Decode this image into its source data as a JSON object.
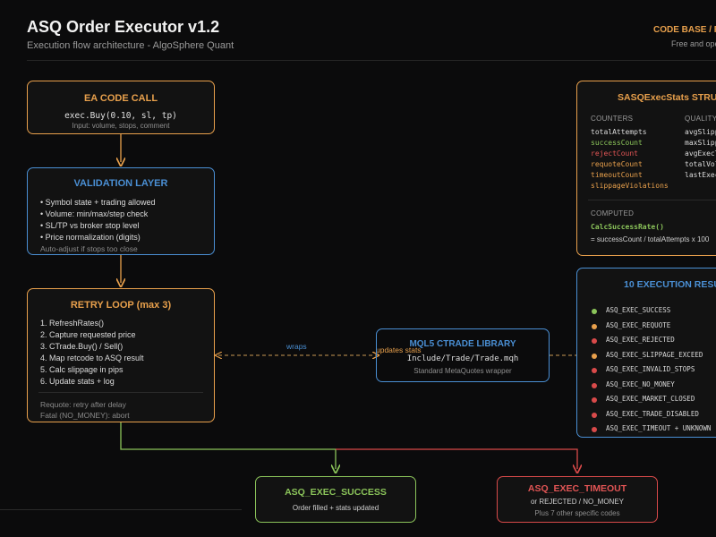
{
  "header": {
    "title": "ASQ Order Executor v1.2",
    "subtitle": "Execution flow architecture - AlgoSphere Quant",
    "codebase_title": "CODE BASE / PU",
    "codebase_sub": "Free and ope"
  },
  "ea_call": {
    "title": "EA CODE CALL",
    "code": "exec.Buy(0.10, sl, tp)",
    "note": "Input: volume, stops, comment"
  },
  "validation": {
    "title": "VALIDATION LAYER",
    "items": [
      "• Symbol state + trading allowed",
      "• Volume: min/max/step check",
      "• SL/TP vs broker stop level",
      "• Price normalization (digits)"
    ],
    "note": "Auto-adjust if stops too close"
  },
  "retry": {
    "title": "RETRY LOOP (max 3)",
    "items": [
      "1. RefreshRates()",
      "2. Capture requested price",
      "3. CTrade.Buy() / Sell()",
      "4. Map retcode to ASQ result",
      "5. Calc slippage in pips",
      "6. Update stats + log"
    ],
    "notes": [
      "Requote: retry after delay",
      "Fatal (NO_MONEY): abort"
    ]
  },
  "library": {
    "title": "MQL5 CTRADE LIBRARY",
    "path": "Include/Trade/Trade.mqh",
    "note": "Standard MetaQuotes wrapper"
  },
  "edges": {
    "wraps": "wraps",
    "updates": "updates stats"
  },
  "stats": {
    "title": "SASQExecStats STRUCT",
    "counters_header": "COUNTERS",
    "quality_header": "QUALITY",
    "counters": [
      {
        "name": "totalAttempts",
        "color": "#dcdcdc"
      },
      {
        "name": "successCount",
        "color": "#8bc45a"
      },
      {
        "name": "rejectCount",
        "color": "#e25555"
      },
      {
        "name": "requoteCount",
        "color": "#e8a04c"
      },
      {
        "name": "timeoutCount",
        "color": "#e8a04c"
      },
      {
        "name": "slippageViolations",
        "color": "#e8a04c"
      }
    ],
    "quality": [
      "avgSlipp",
      "maxSlipp",
      "avgExecT",
      "totalVol",
      "lastExec"
    ],
    "computed_header": "COMPUTED",
    "computed_fn": "CalcSuccessRate()",
    "computed_formula": "= successCount / totalAttempts x 100"
  },
  "results": {
    "title": "10 EXECUTION RESU",
    "items": [
      {
        "code": "ASQ_EXEC_SUCCESS",
        "color": "#8bc45a"
      },
      {
        "code": "ASQ_EXEC_REQUOTE",
        "color": "#e8a04c"
      },
      {
        "code": "ASQ_EXEC_REJECTED",
        "color": "#d94a4a"
      },
      {
        "code": "ASQ_EXEC_SLIPPAGE_EXCEED",
        "color": "#e8a04c"
      },
      {
        "code": "ASQ_EXEC_INVALID_STOPS",
        "color": "#d94a4a"
      },
      {
        "code": "ASQ_EXEC_NO_MONEY",
        "color": "#d94a4a"
      },
      {
        "code": "ASQ_EXEC_MARKET_CLOSED",
        "color": "#d94a4a"
      },
      {
        "code": "ASQ_EXEC_TRADE_DISABLED",
        "color": "#d94a4a"
      },
      {
        "code": "ASQ_EXEC_TIMEOUT + UNKNOWN",
        "color": "#d94a4a"
      }
    ]
  },
  "outcome_success": {
    "title": "ASQ_EXEC_SUCCESS",
    "sub": "Order filled + stats updated"
  },
  "outcome_timeout": {
    "title": "ASQ_EXEC_TIMEOUT",
    "sub": "or REJECTED / NO_MONEY",
    "note": "Plus 7 other specific codes"
  },
  "colors": {
    "orange": "#e8a04c",
    "blue": "#4a8fd4",
    "green": "#8bc45a",
    "red": "#d94a4a"
  }
}
